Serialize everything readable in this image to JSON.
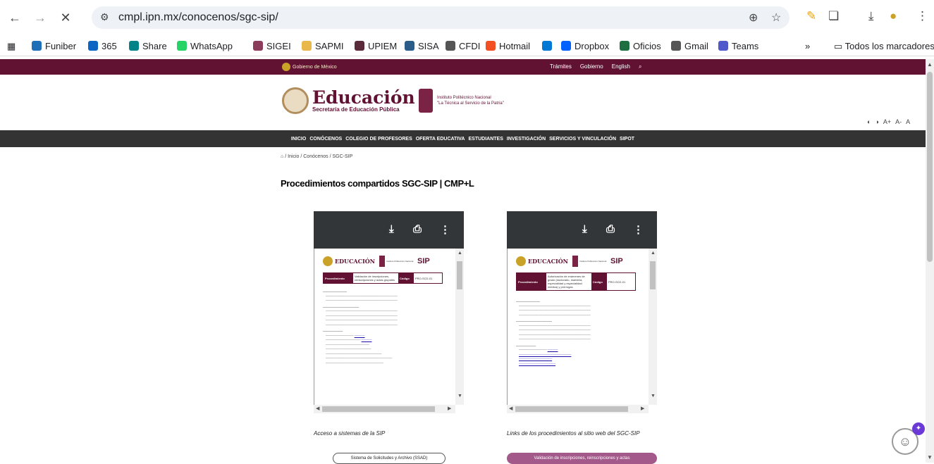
{
  "browser": {
    "url": "cmpl.ipn.mx/conocenos/sgc-sip/",
    "bookmarks": [
      {
        "label": "Funiber",
        "color": "#1e6fb8"
      },
      {
        "label": "365",
        "color": "#0a66c2"
      },
      {
        "label": "Share",
        "color": "#038387"
      },
      {
        "label": "WhatsApp",
        "color": "#25d366"
      },
      {
        "label": "SIGEI",
        "color": "#8a3c5a"
      },
      {
        "label": "SAPMI",
        "color": "#e8b84a"
      },
      {
        "label": "UPIEM",
        "color": "#5a2a3a"
      },
      {
        "label": "SISA",
        "color": "#2a5d8a"
      },
      {
        "label": "CFDI",
        "color": "#555555"
      },
      {
        "label": "Hotmail",
        "color": "#f25022"
      },
      {
        "label": "",
        "color": "#0078d4"
      },
      {
        "label": "Dropbox",
        "color": "#0061fe"
      },
      {
        "label": "Oficios",
        "color": "#1d6f42"
      },
      {
        "label": "Gmail",
        "color": "#555555"
      },
      {
        "label": "Teams",
        "color": "#5059c9"
      }
    ],
    "all_bookmarks": "Todos los marcadores"
  },
  "gov_bar": {
    "logo_text": "Gobierno de México",
    "links": [
      "Trámites",
      "Gobierno",
      "English"
    ]
  },
  "header": {
    "sep_name": "Educación",
    "sep_sub": "Secretaría de Educación Pública",
    "ipn_line1": "Instituto Politécnico Nacional",
    "ipn_line2": "\"La Técnica al Servicio de la Patria\"",
    "access": [
      "A+",
      "A-",
      "A"
    ]
  },
  "nav": [
    "INICIO",
    "CONÓCENOS",
    "COLEGIO DE PROFESORES",
    "OFERTA EDUCATIVA",
    "ESTUDIANTES",
    "INVESTIGACIÓN",
    "SERVICIOS Y VINCULACIÓN",
    "SIPOT"
  ],
  "breadcrumb": "/ Inicio / Conócenos / SGC-SIP",
  "title": "Procedimientos compartidos SGC-SIP | CMP+L",
  "viewers": [
    {
      "doc_title": "EDUCACIÓN",
      "ipn_text": "Instituto Politécnico Nacional",
      "sip": "SIP",
      "proc_label": "Procedimiento",
      "proc_value": "Validación de inscripciones, reinscripciones y actas grupales",
      "code_label": "Código",
      "code_value": "PRO-SCD-01",
      "caption": "Acceso a sistemas de la SIP",
      "button": "Sistema de Solicitudes y Archivo (SSAD)"
    },
    {
      "doc_title": "EDUCACIÓN",
      "ipn_text": "Instituto Politécnico Nacional",
      "sip": "SIP",
      "proc_label": "Procedimiento",
      "proc_value": "Autorización de exámenes de grado (doctorado, maestría, especialidad y especialidad médica) y prórrogas",
      "code_label": "Código",
      "code_value": "PRO-SCD-01",
      "caption": "Links de los procedimientos al sitio web del SGC-SIP",
      "button": "Validación de inscripciones, reinscripciones y actas"
    }
  ]
}
